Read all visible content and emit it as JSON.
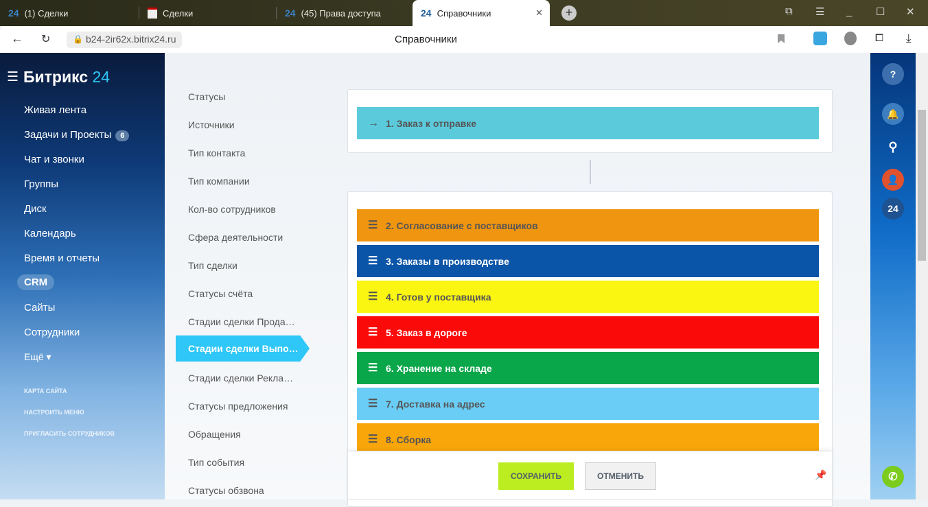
{
  "browser": {
    "tabs": [
      {
        "label": "(1) Сделки",
        "icon": "24"
      },
      {
        "label": "Сделки",
        "icon": "favicon"
      },
      {
        "label": "(45) Права доступа",
        "icon": "24"
      },
      {
        "label": "Справочники",
        "icon": "24",
        "active": true
      }
    ],
    "url": "b24-2ir62x.bitrix24.ru",
    "page_title": "Справочники"
  },
  "sidebar": {
    "logo": "Битрикс",
    "logo_num": "24",
    "items": [
      {
        "label": "Живая лента"
      },
      {
        "label": "Задачи и Проекты",
        "badge": "6"
      },
      {
        "label": "Чат и звонки"
      },
      {
        "label": "Группы"
      },
      {
        "label": "Диск"
      },
      {
        "label": "Календарь"
      },
      {
        "label": "Время и отчеты"
      },
      {
        "label": "CRM",
        "active": true
      },
      {
        "label": "Сайты"
      },
      {
        "label": "Сотрудники"
      },
      {
        "label": "Ещё ▾"
      }
    ],
    "links": [
      "КАРТА САЙТА",
      "НАСТРОИТЬ МЕНЮ",
      "ПРИГЛАСИТЬ СОТРУДНИКОВ"
    ]
  },
  "menu": [
    "Статусы",
    "Источники",
    "Тип контакта",
    "Тип компании",
    "Кол-во сотрудников",
    "Сфера деятельности",
    "Тип сделки",
    "Статусы счёта",
    "Стадии сделки Прода…",
    "Стадии сделки Выпо…",
    "Стадии сделки Рекла…",
    "Статусы предложения",
    "Обращения",
    "Тип события",
    "Статусы обзвона"
  ],
  "menu_active": 9,
  "first_stage": {
    "label": "1. Заказ к отправке",
    "color": "#5bcbdc"
  },
  "stages": [
    {
      "label": "2. Согласование с поставщиков",
      "color": "#f0950f",
      "text": "#555555"
    },
    {
      "label": "3. Заказы в производстве",
      "color": "#0b55a8",
      "text": "#ffffff"
    },
    {
      "label": "4. Готов у поставщика",
      "color": "#fbf512",
      "text": "#555555"
    },
    {
      "label": "5. Заказ в дороге",
      "color": "#fb0a0a",
      "text": "#ffffff"
    },
    {
      "label": "6. Хранение на складе",
      "color": "#0aa64a",
      "text": "#ffffff"
    },
    {
      "label": "7. Доставка на адрес",
      "color": "#6acdf5",
      "text": "#555555"
    },
    {
      "label": "8. Сборка",
      "color": "#f9a60a",
      "text": "#555555"
    }
  ],
  "footer": {
    "save": "СОХРАНИТЬ",
    "cancel": "ОТМЕНИТЬ"
  },
  "rightbar": {
    "counter": "24"
  }
}
